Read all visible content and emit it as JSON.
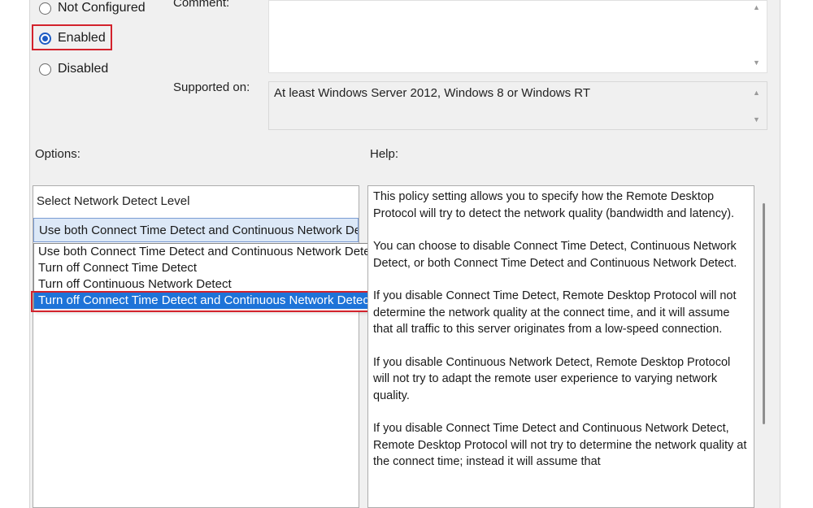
{
  "state": {
    "not_configured": "Not Configured",
    "enabled": "Enabled",
    "disabled": "Disabled",
    "selected": "Enabled"
  },
  "comment_label": "Comment:",
  "supported_on_label": "Supported on:",
  "supported_on_value": "At least Windows Server 2012, Windows 8 or Windows RT",
  "options_label": "Options:",
  "help_label": "Help:",
  "options": {
    "field_label": "Select Network Detect Level",
    "combo_value": "Use both Connect Time Detect and Continuous Network Detect",
    "dropdown_items": [
      "Use both Connect Time Detect and Continuous Network Detect",
      "Turn off Connect Time Detect",
      "Turn off Continuous Network Detect",
      "Turn off Connect Time Detect and Continuous Network Detect"
    ],
    "highlighted_item": "Turn off Connect Time Detect and Continuous Network Detect"
  },
  "help": {
    "paragraphs": [
      "This policy setting allows you to specify how the Remote Desktop Protocol will try to detect the network quality (bandwidth and latency).",
      "You can choose to disable Connect Time Detect, Continuous Network Detect, or both Connect Time Detect and Continuous Network Detect.",
      "If you disable Connect Time Detect, Remote Desktop Protocol will not determine the network quality at the connect time, and it will assume that all traffic to this server originates from a low-speed connection.",
      "If you disable Continuous Network Detect, Remote Desktop Protocol will not try to adapt the remote user experience to varying network quality.",
      "If you disable Connect Time Detect and Continuous Network Detect, Remote Desktop Protocol will not try to determine the network quality at the connect time; instead it will assume that"
    ]
  },
  "icons": {
    "scroll_up": "scroll-up-arrow-icon",
    "scroll_down": "scroll-down-arrow-icon"
  },
  "colors": {
    "accent": "#1e73d8",
    "highlight_box": "#d3222c"
  }
}
